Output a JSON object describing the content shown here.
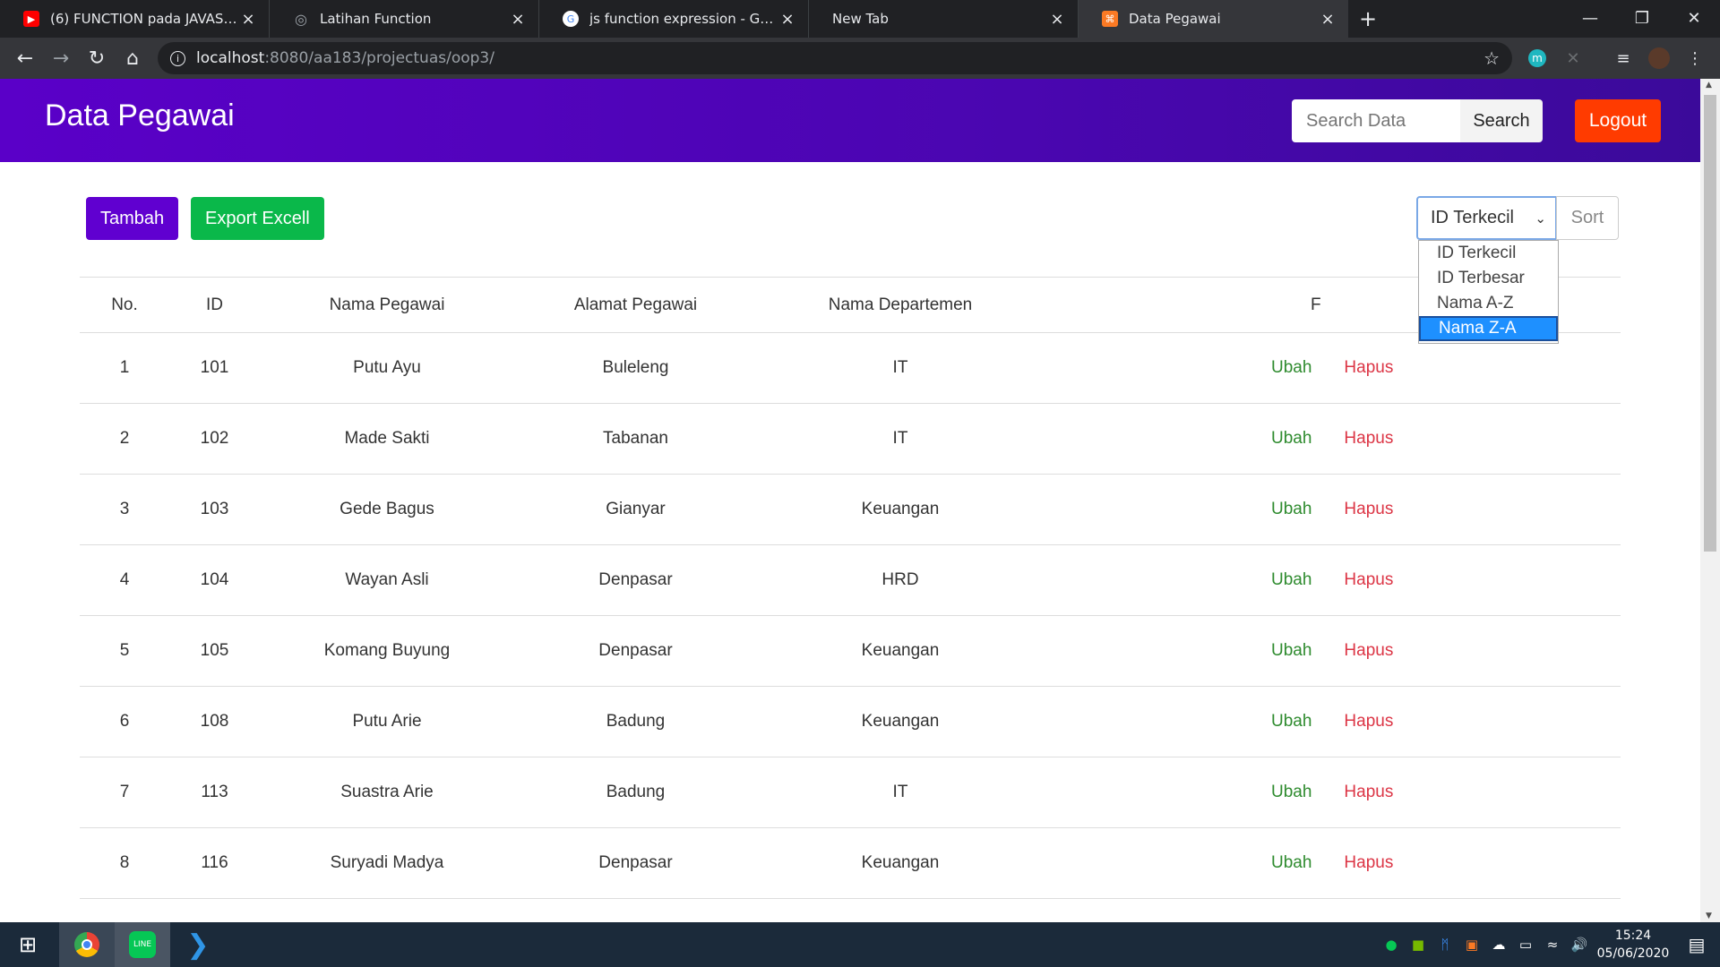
{
  "browser": {
    "tabs": [
      {
        "title": "(6) FUNCTION pada JAVASCRIPT",
        "icon": "youtube-icon",
        "color": "#ff0000"
      },
      {
        "title": "Latihan Function",
        "icon": "globe-icon",
        "color": "#9aa0a6"
      },
      {
        "title": "js function expression - Google P",
        "icon": "google-icon",
        "color": "#4285f4"
      },
      {
        "title": "New Tab",
        "icon": "",
        "color": ""
      },
      {
        "title": "Data Pegawai",
        "icon": "xampp-icon",
        "color": "#fb7a24"
      }
    ],
    "active_tab": 4,
    "url_host": "localhost",
    "url_path": ":8080/aa183/projectuas/oop3/"
  },
  "app": {
    "brand": "Data Pegawai",
    "search_placeholder": "Search Data",
    "search_button": "Search",
    "logout_button": "Logout",
    "add_button": "Tambah",
    "export_button": "Export Excell",
    "sort_selected": "ID Terkecil",
    "sort_button": "Sort",
    "sort_options": [
      "ID Terkecil",
      "ID Terbesar",
      "Nama A-Z",
      "Nama Z-A"
    ],
    "sort_highlighted": 3,
    "colors": {
      "header": "#4a06b0",
      "add": "#6000d0",
      "export": "#0ab84a",
      "logout": "#ff3b00",
      "edit": "#2e8b2e",
      "delete": "#dc3545"
    }
  },
  "table": {
    "headers": [
      "No.",
      "ID",
      "Nama Pegawai",
      "Alamat Pegawai",
      "Nama Departemen",
      "F"
    ],
    "edit_label": "Ubah",
    "delete_label": "Hapus",
    "rows": [
      [
        "1",
        "101",
        "Putu Ayu",
        "Buleleng",
        "IT"
      ],
      [
        "2",
        "102",
        "Made Sakti",
        "Tabanan",
        "IT"
      ],
      [
        "3",
        "103",
        "Gede Bagus",
        "Gianyar",
        "Keuangan"
      ],
      [
        "4",
        "104",
        "Wayan Asli",
        "Denpasar",
        "HRD"
      ],
      [
        "5",
        "105",
        "Komang Buyung",
        "Denpasar",
        "Keuangan"
      ],
      [
        "6",
        "108",
        "Putu Arie",
        "Badung",
        "Keuangan"
      ],
      [
        "7",
        "113",
        "Suastra Arie",
        "Badung",
        "IT"
      ],
      [
        "8",
        "116",
        "Suryadi Madya",
        "Denpasar",
        "Keuangan"
      ]
    ]
  },
  "taskbar": {
    "time": "15:24",
    "date": "05/06/2020"
  }
}
